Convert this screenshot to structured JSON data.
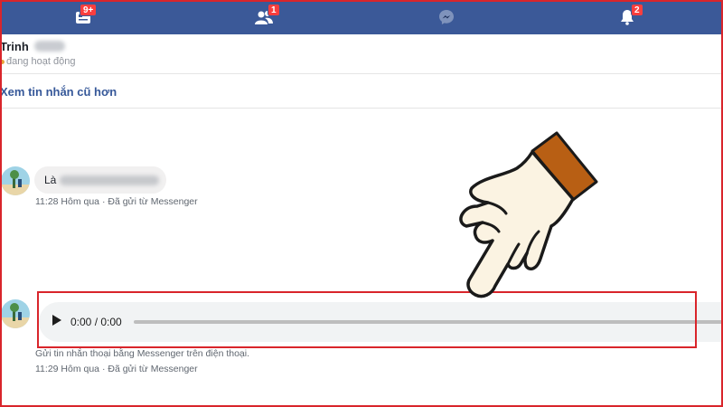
{
  "navbar": {
    "items": [
      {
        "icon": "home-feed-icon",
        "badge": "9+"
      },
      {
        "icon": "friend-requests-icon",
        "badge": "1"
      },
      {
        "icon": "messenger-icon",
        "badge": ""
      },
      {
        "icon": "notifications-bell-icon",
        "badge": "2"
      }
    ],
    "color": "#3b5998",
    "badge_color": "#fa3e3e"
  },
  "conversation": {
    "name": "Trinh",
    "status": "đang hoạt động"
  },
  "older_messages_link": "Xem tin nhắn cũ hơn",
  "messages": [
    {
      "text": "Là",
      "time": "11:28 Hôm qua",
      "sent_via": "Đã gửi từ Messenger"
    },
    {
      "type": "audio",
      "current_time": "0:00",
      "duration": "0:00",
      "time_display": "0:00 / 0:00",
      "caption": "Gửi tin nhắn thoại bằng Messenger trên điện thoại.",
      "time": "11:29 Hôm qua",
      "sent_via": "Đã gửi từ Messenger"
    }
  ],
  "meta_separator": " · ",
  "highlight_color": "#d9252b"
}
